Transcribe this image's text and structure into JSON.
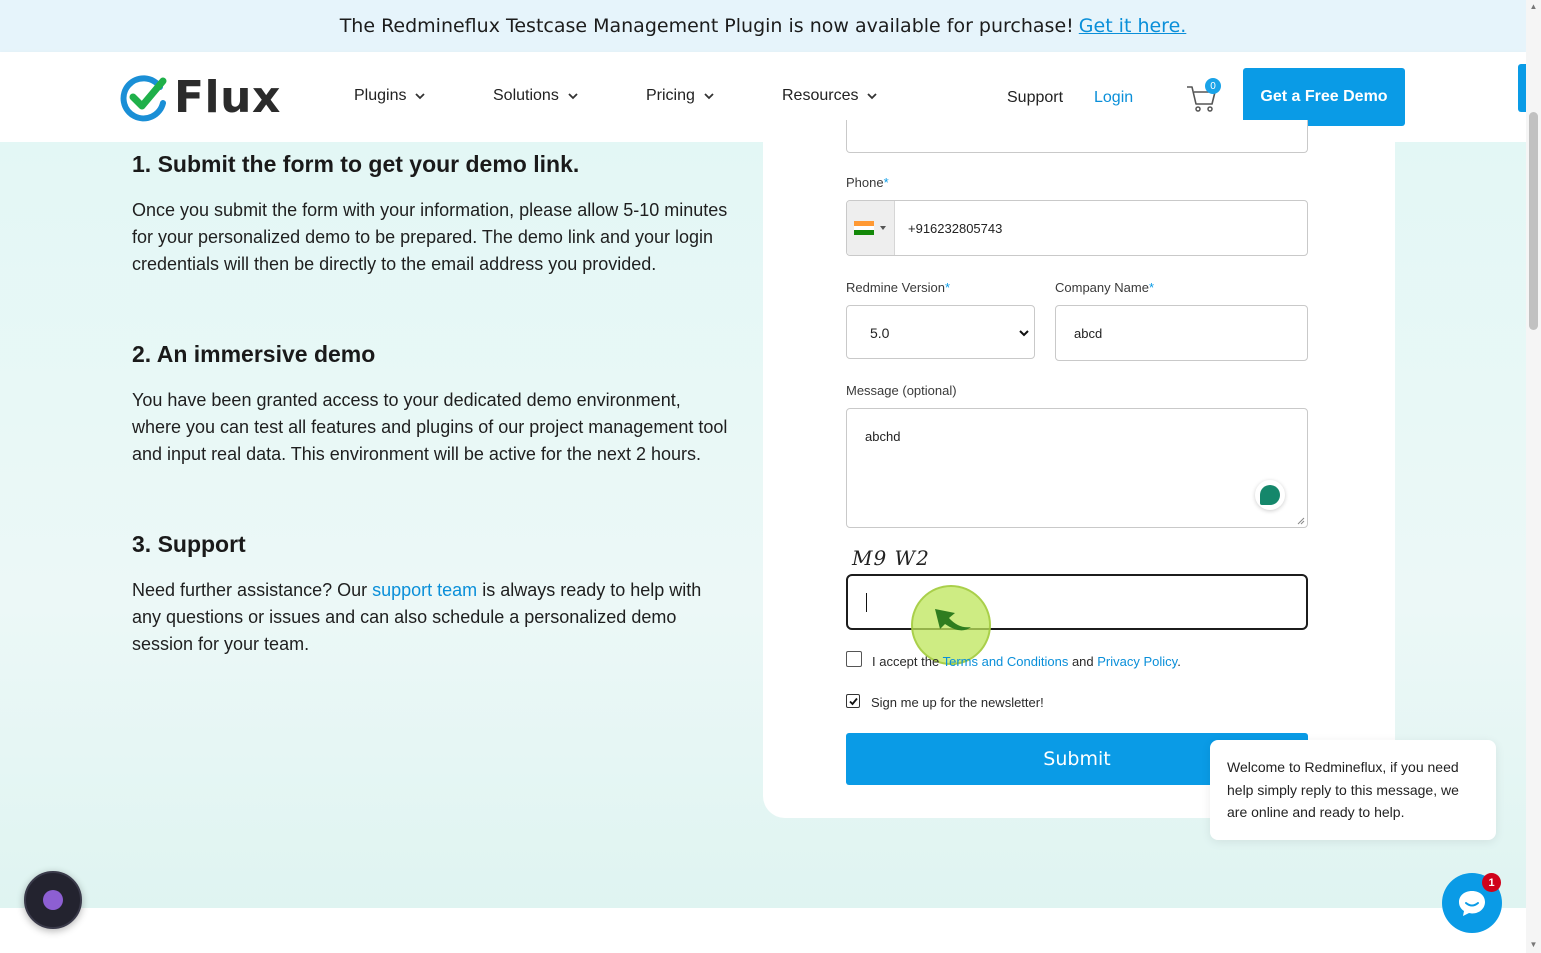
{
  "announcement": {
    "text": "The Redmineflux Testcase Management Plugin is now available for purchase!",
    "link": "Get it here."
  },
  "nav": {
    "logo_text": "Flux",
    "items": [
      {
        "label": "Plugins"
      },
      {
        "label": "Solutions"
      },
      {
        "label": "Pricing"
      },
      {
        "label": "Resources"
      }
    ],
    "support": "Support",
    "login": "Login",
    "cart_count": "0",
    "cta": "Get a Free Demo"
  },
  "steps": [
    {
      "title": "1. Submit the form to get your demo link.",
      "body": "Once you submit the form with your information, please allow 5-10 minutes for your personalized demo to be prepared. The demo link and your login credentials will then be directly to the email address you provided."
    },
    {
      "title": "2. An immersive demo",
      "body": "You have been granted access to your dedicated demo environment, where you can test all features and plugins of our project management tool and input real data. This environment will be active for the next 2 hours."
    },
    {
      "title": "3. Support",
      "body_before": "Need further assistance? Our ",
      "body_link": "support team",
      "body_after": " is always ready to help with any questions or issues and can also schedule a personalized demo session for your team."
    }
  ],
  "form": {
    "phone_label": "Phone",
    "required_mark": "*",
    "phone_value": "+916232805743",
    "redmine_label": "Redmine Version",
    "redmine_value": "5.0",
    "company_label": "Company Name",
    "company_value": "abcd",
    "message_label": "Message (optional)",
    "message_value": "abchd",
    "captcha_text": "M9 W2",
    "captcha_value": "",
    "terms_prefix": "I accept the ",
    "terms_link": "Terms and Conditions",
    "terms_and": " and ",
    "privacy_link": "Privacy Policy",
    "terms_suffix": ".",
    "terms_checked": false,
    "newsletter_label": "Sign me up for the newsletter!",
    "newsletter_checked": true,
    "submit": "Submit"
  },
  "chat": {
    "message": "Welcome to Redmineflux, if you need help simply reply to this message, we are online and ready to help.",
    "badge": "1"
  },
  "colors": {
    "accent": "#0a9be6",
    "logo_green": "#1fb04a",
    "hero_bg": "#e3f7f5"
  }
}
